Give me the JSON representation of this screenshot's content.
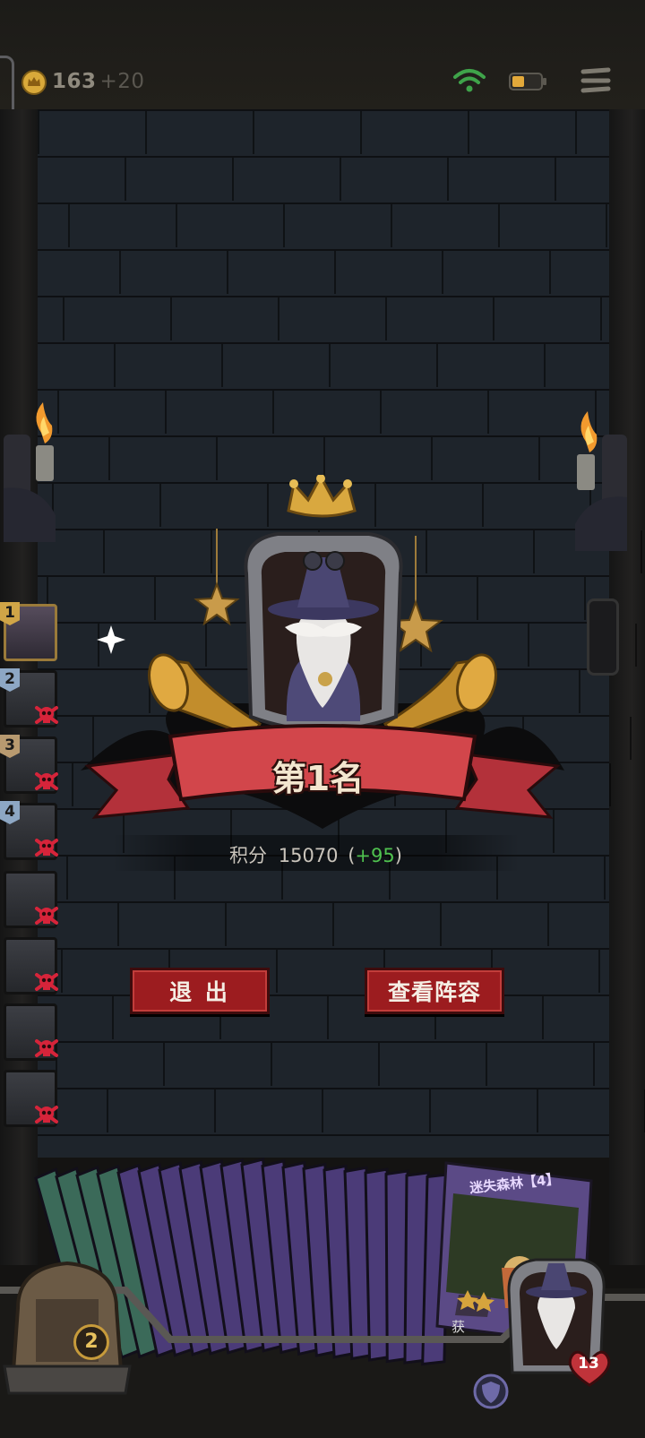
{
  "topbar": {
    "coins": "163",
    "coins_bonus": "+20",
    "icons": [
      "crown-coin-icon",
      "wifi-icon",
      "battery-icon",
      "menu-icon"
    ]
  },
  "result": {
    "rank_title": "第1名",
    "score_label": "积分",
    "score_value": "15070",
    "score_open": "(",
    "score_delta": "+95",
    "score_close": ")"
  },
  "buttons": {
    "exit": "退 出",
    "view_lineup": "查看阵容"
  },
  "roster": [
    {
      "rank": "1",
      "defeated": false
    },
    {
      "rank": "2",
      "defeated": true
    },
    {
      "rank": "3",
      "defeated": true
    },
    {
      "rank": "4",
      "defeated": true
    },
    {
      "rank": "",
      "defeated": true
    },
    {
      "rank": "",
      "defeated": true
    },
    {
      "rank": "",
      "defeated": true
    },
    {
      "rank": "",
      "defeated": true
    }
  ],
  "deck": {
    "top_card_name": "迷失森林【4】",
    "top_card_text": "获",
    "remaining": "2",
    "hero_hp": "13"
  },
  "colors": {
    "banner": "#d2464b",
    "button": "#9c1c1f",
    "delta_green": "#4fc24f",
    "gold": "#c9a24a"
  }
}
